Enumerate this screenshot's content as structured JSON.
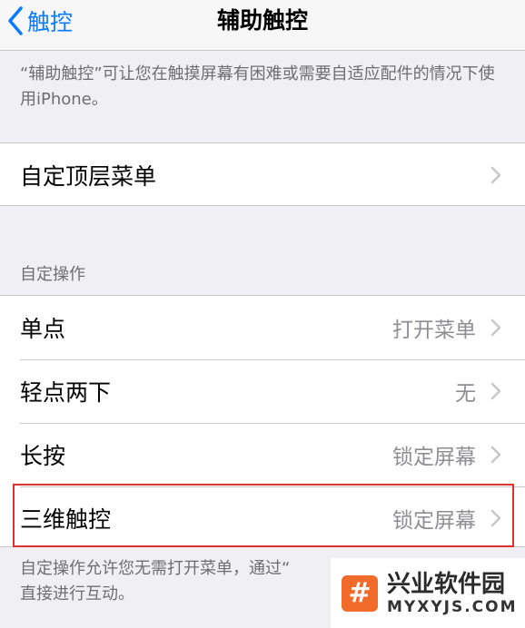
{
  "navbar": {
    "back_label": "触控",
    "title": "辅助触控"
  },
  "description_top": "“辅助触控”可让您在触摸屏幕有困难或需要自适应配件的情况下使用iPhone。",
  "top_group": {
    "label": "自定顶层菜单"
  },
  "actions_section": {
    "header": "自定操作",
    "items": [
      {
        "label": "单点",
        "value": "打开菜单"
      },
      {
        "label": "轻点两下",
        "value": "无"
      },
      {
        "label": "长按",
        "value": "锁定屏幕"
      },
      {
        "label": "三维触控",
        "value": "锁定屏幕"
      }
    ]
  },
  "description_bottom": "自定操作允许您无需打开菜单，通过“",
  "description_bottom_line2": "直接进行互动。",
  "watermark": {
    "name": "兴业软件园",
    "url": "MYXYJS.COM"
  },
  "colors": {
    "accent": "#0a7aff",
    "highlight": "#e2312d",
    "watermark_logo": "#f36b2a"
  }
}
